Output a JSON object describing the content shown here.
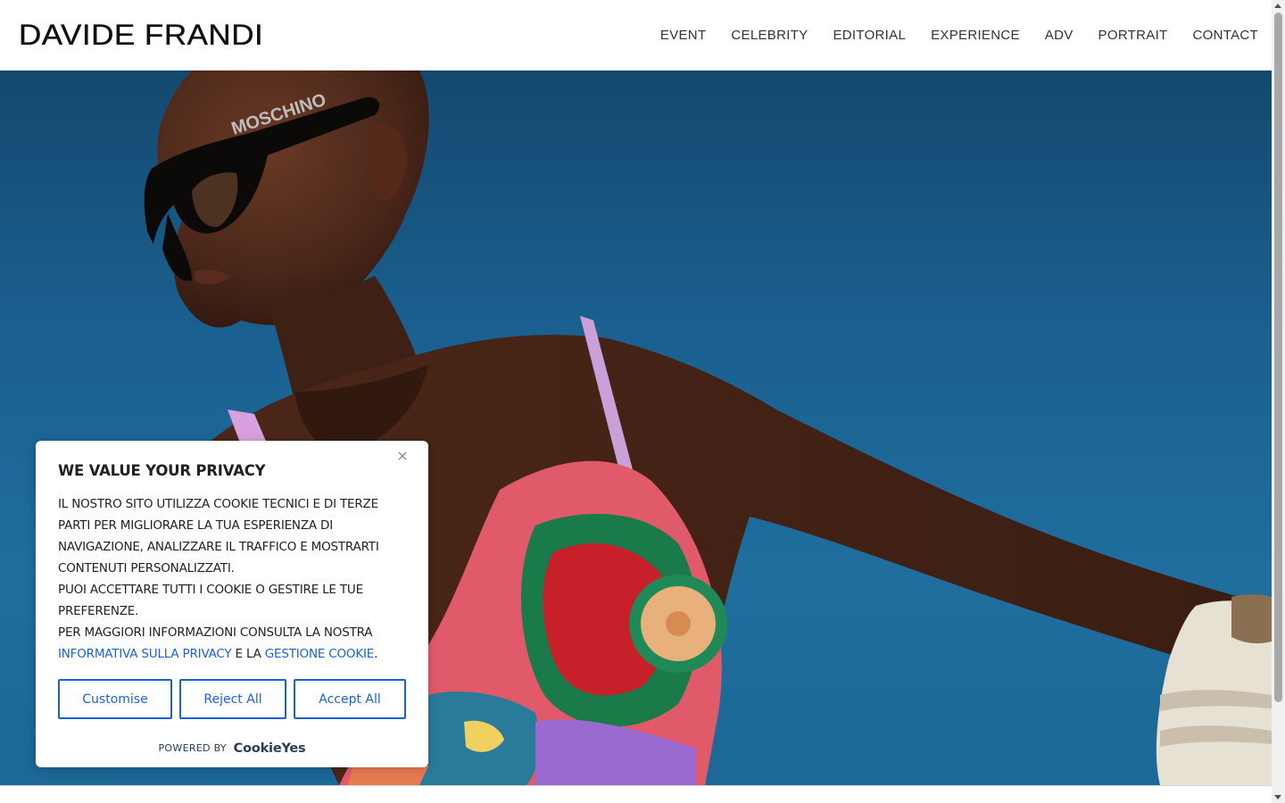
{
  "header": {
    "logo": "DAVIDE FRANDI",
    "nav": [
      {
        "label": "EVENT"
      },
      {
        "label": "CELEBRITY"
      },
      {
        "label": "EDITORIAL"
      },
      {
        "label": "EXPERIENCE"
      },
      {
        "label": "ADV"
      },
      {
        "label": "PORTRAIT"
      },
      {
        "label": "CONTACT"
      }
    ]
  },
  "hero": {
    "image_icon": "fashion-photo",
    "sunglasses_text": "MOSCHINO",
    "colors": {
      "sky": "#1a5f8f",
      "skin": "#4a2a1d"
    }
  },
  "cookie_banner": {
    "title": "WE VALUE YOUR PRIVACY",
    "paragraph_1": "IL NOSTRO SITO UTILIZZA COOKIE TECNICI E DI TERZE PARTI PER MIGLIORARE LA TUA ESPERIENZA DI NAVIGAZIONE, ANALIZZARE IL TRAFFICO E MOSTRARTI CONTENUTI PERSONALIZZATI.",
    "paragraph_2": "PUOI ACCETTARE TUTTI I COOKIE O GESTIRE LE TUE PREFERENZE.",
    "paragraph_3_prefix": "PER MAGGIORI INFORMAZIONI CONSULTA LA NOSTRA ",
    "privacy_link": "INFORMATIVA SULLA PRIVACY",
    "paragraph_3_middle": " E LA ",
    "cookie_link": "GESTIONE COOKIE",
    "paragraph_3_suffix": ".",
    "buttons": {
      "customise": "Customise",
      "reject": "Reject All",
      "accept": "Accept All"
    },
    "powered_by": "POWERED BY",
    "brand": "CookieYes",
    "close_icon": "close-icon",
    "accent_color": "#1863dc"
  }
}
